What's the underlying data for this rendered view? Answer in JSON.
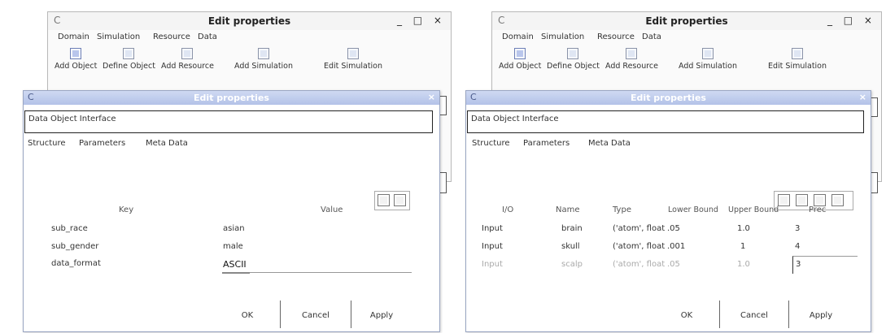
{
  "left": {
    "back": {
      "title": "Edit properties",
      "app_icon": "C",
      "controls": "_ □ ×",
      "menu": [
        "Domain",
        "Simulation",
        "Resource",
        "Data"
      ],
      "tools": [
        "Add Object",
        "Define Object",
        "Add Resource",
        "Add Simulation",
        "Edit Simulation"
      ]
    },
    "dialog": {
      "title": "Edit properties",
      "close": "×",
      "field": "Data Object Interface",
      "tabs": [
        "Structure",
        "Parameters",
        "Meta Data"
      ],
      "headers": {
        "key": "Key",
        "value": "Value"
      },
      "rows": [
        {
          "key": "sub_race",
          "value": "asian"
        },
        {
          "key": "sub_gender",
          "value": "male"
        },
        {
          "key": "data_format",
          "value": "ASCII"
        }
      ],
      "buttons": [
        "OK",
        "Cancel",
        "Apply"
      ]
    }
  },
  "right": {
    "back": {
      "title": "Edit properties",
      "app_icon": "C",
      "controls": "_ □ ×",
      "menu": [
        "Domain",
        "Simulation",
        "Resource",
        "Data"
      ],
      "tools": [
        "Add Object",
        "Define Object",
        "Add Resource",
        "Add Simulation",
        "Edit Simulation"
      ]
    },
    "dialog": {
      "title": "Edit properties",
      "close": "×",
      "field": "Data Object Interface",
      "tabs": [
        "Structure",
        "Parameters",
        "Meta Data"
      ],
      "headers": {
        "io": "I/O",
        "name": "Name",
        "type": "Type",
        "lower": "Lower Bound",
        "upper": "Upper Bound",
        "prec": "Prec"
      },
      "rows": [
        {
          "io": "Input",
          "name": "brain",
          "type": "('atom', float",
          "lower": ".05",
          "upper": "1.0",
          "prec": "3"
        },
        {
          "io": "Input",
          "name": "skull",
          "type": "('atom', float",
          "lower": ".001",
          "upper": "1",
          "prec": "4"
        },
        {
          "io": "Input",
          "name": "scalp",
          "type": "('atom', float",
          "lower": ".05",
          "upper": "1.0",
          "prec": "3"
        }
      ],
      "buttons": [
        "OK",
        "Cancel",
        "Apply"
      ]
    }
  }
}
